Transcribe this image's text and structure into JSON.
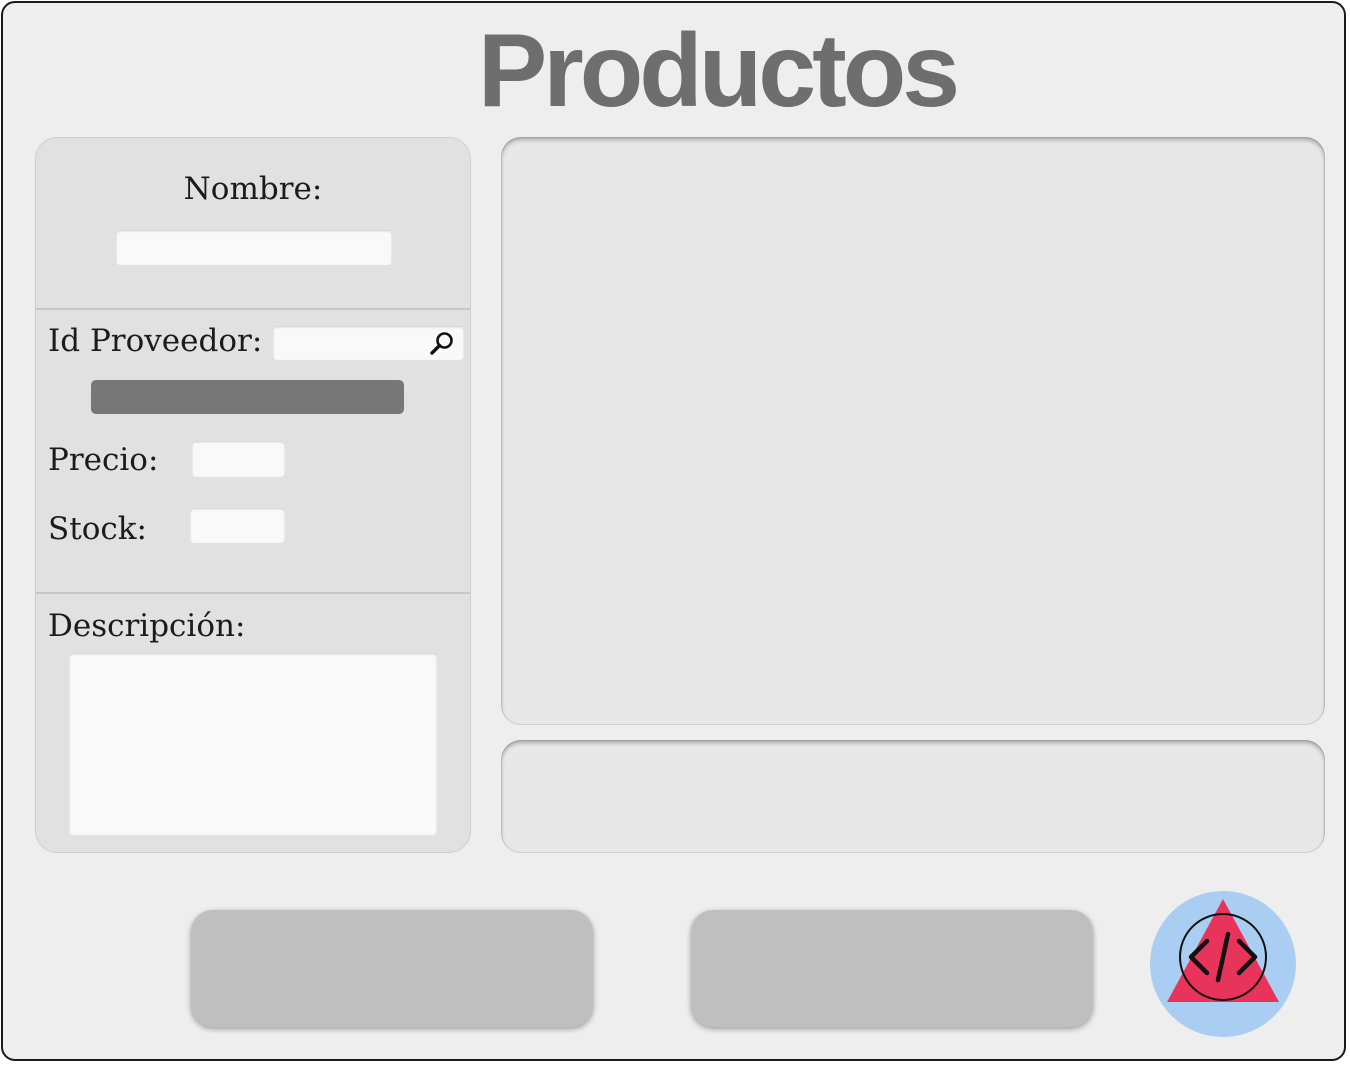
{
  "page": {
    "title": "Productos"
  },
  "form": {
    "nombre_label": "Nombre:",
    "proveedor_label": "Id Proveedor:",
    "precio_label": "Precio:",
    "stock_label": "Stock:",
    "descripcion_label": "Descripción:"
  },
  "logo": {
    "icon": "code-icon",
    "circle_color": "#a9cef2",
    "triangle_color": "#e8345a"
  },
  "colors": {
    "background": "#eeeeee",
    "panel": "#e1e1e1",
    "title_text": "#6e6e6e",
    "button": "#bfbfbf",
    "proveedor_name_bar": "#777777"
  }
}
